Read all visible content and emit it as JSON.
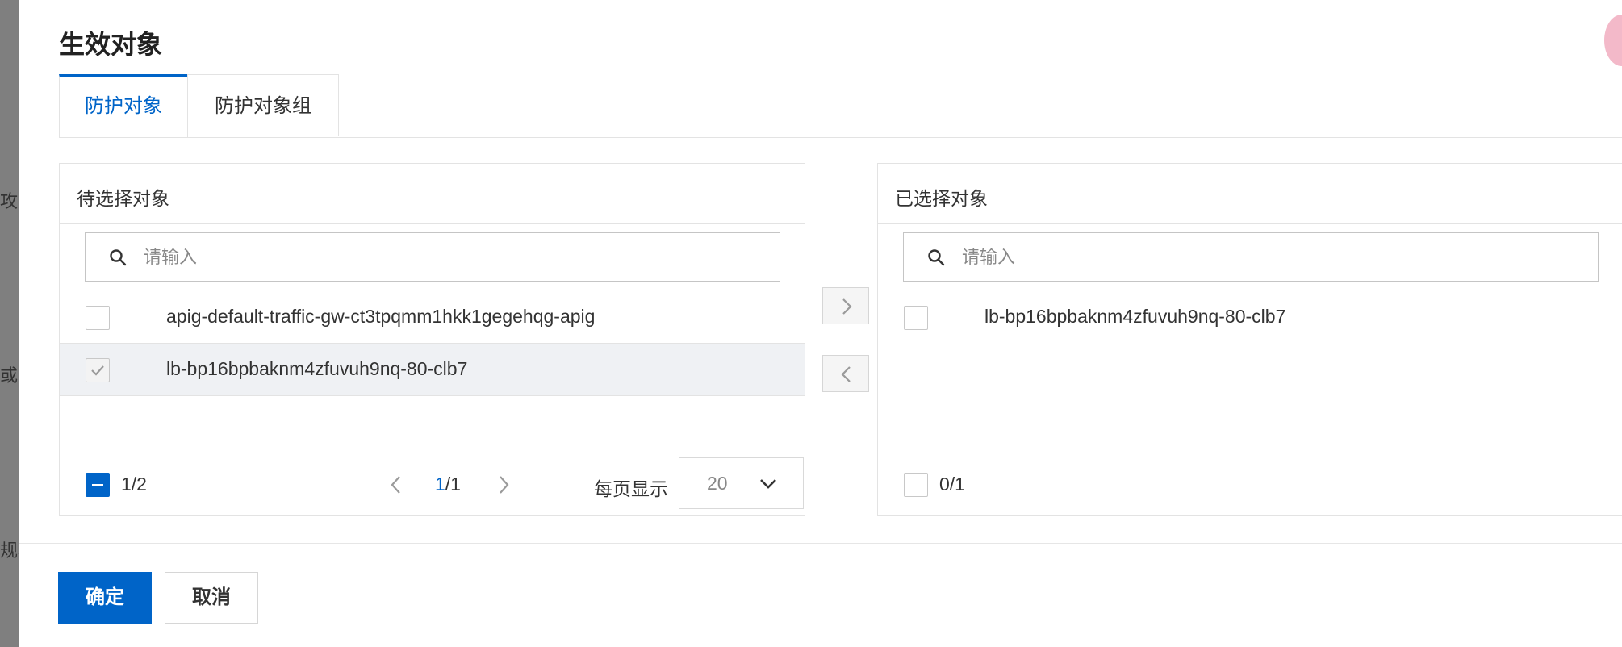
{
  "background": {
    "side_texts": [
      "攻击",
      "或页",
      "规格"
    ]
  },
  "dialog": {
    "title": "生效对象",
    "tabs": [
      {
        "label": "防护对象",
        "active": true
      },
      {
        "label": "防护对象组",
        "active": false
      }
    ],
    "left_panel": {
      "title": "待选择对象",
      "search_placeholder": "请输入",
      "items": [
        {
          "label": "apig-default-traffic-gw-ct3tpqmm1hkk1gegehqg-apig",
          "checked": false,
          "selected": false
        },
        {
          "label": "lb-bp16bpbaknm4zfuvuh9nq-80-clb7",
          "checked": true,
          "selected": true
        }
      ],
      "count": "1/2",
      "pagination": {
        "current": "1",
        "separator": "/1"
      },
      "page_size_label": "每页显示",
      "page_size_value": "20"
    },
    "right_panel": {
      "title": "已选择对象",
      "search_placeholder": "请输入",
      "items": [
        {
          "label": "lb-bp16bpbaknm4zfuvuh9nq-80-clb7",
          "checked": false
        }
      ],
      "count": "0/1"
    },
    "buttons": {
      "confirm": "确定",
      "cancel": "取消"
    },
    "colors": {
      "primary": "#0064c8",
      "selected_row": "#eff1f4",
      "border": "#e3e3e3"
    }
  }
}
